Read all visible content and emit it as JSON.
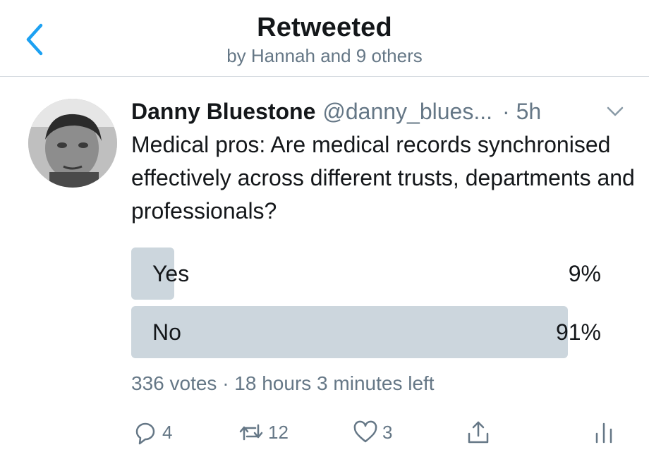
{
  "header": {
    "title": "Retweeted",
    "subtitle": "by Hannah and 9 others",
    "back_icon": "chevron-left-icon"
  },
  "tweet": {
    "author_name": "Danny Bluestone",
    "handle": "@danny_blues...",
    "time": "· 5h",
    "text": "Medical pros: Are medical records synchronised effectively across different trusts, departments and professionals?"
  },
  "poll": {
    "options": [
      {
        "label": "Yes",
        "percent_text": "9%",
        "percent": 9
      },
      {
        "label": "No",
        "percent_text": "91%",
        "percent": 91
      }
    ],
    "meta": "336 votes · 18 hours 3 minutes left"
  },
  "actions": {
    "reply_count": "4",
    "retweet_count": "12",
    "like_count": "3"
  },
  "colors": {
    "accent": "#1da1f2",
    "poll_bar": "#ccd6dd",
    "secondary_text": "#657786"
  }
}
